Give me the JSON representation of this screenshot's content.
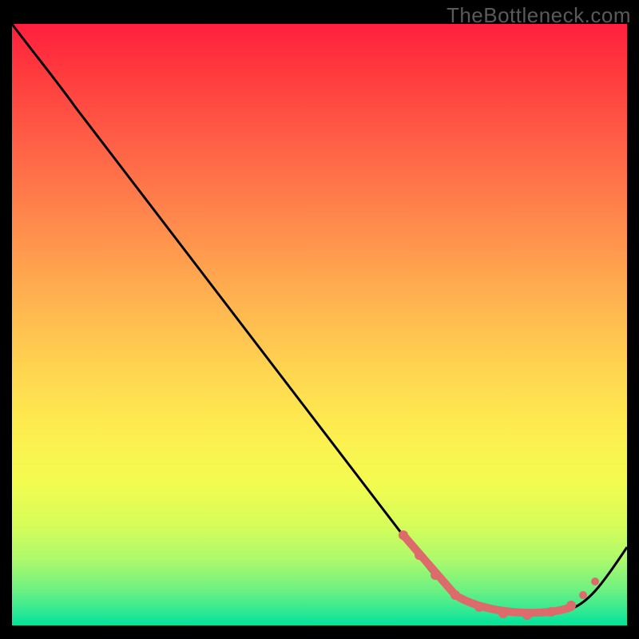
{
  "watermark": "TheBottleneck.com",
  "chart_data": {
    "type": "line",
    "title": "",
    "xlabel": "",
    "ylabel": "",
    "xlim": [
      0,
      100
    ],
    "ylim": [
      0,
      100
    ],
    "grid": false,
    "legend": false,
    "series": [
      {
        "name": "curve",
        "color": "#000000",
        "x": [
          0,
          6,
          12,
          18,
          24,
          30,
          36,
          42,
          48,
          54,
          60,
          66,
          72,
          78,
          84,
          88,
          92,
          96,
          100
        ],
        "y": [
          100,
          95,
          88,
          80,
          72,
          64,
          56,
          48,
          40,
          32,
          24,
          16,
          9,
          4,
          2,
          2,
          4,
          8,
          14
        ]
      },
      {
        "name": "highlight-dots",
        "color": "#e06060",
        "type": "scatter",
        "x": [
          62,
          66,
          70,
          74,
          78,
          82,
          85,
          88,
          90,
          93,
          95
        ],
        "y": [
          17,
          12,
          8,
          5,
          3,
          2,
          2,
          2,
          3,
          5,
          8
        ]
      }
    ],
    "background_gradient": {
      "direction": "vertical",
      "stops": [
        {
          "pos": 0.0,
          "color": "#ff1f3e"
        },
        {
          "pos": 0.5,
          "color": "#ffd650"
        },
        {
          "pos": 0.8,
          "color": "#d8fd58"
        },
        {
          "pos": 1.0,
          "color": "#00e39c"
        }
      ]
    }
  }
}
